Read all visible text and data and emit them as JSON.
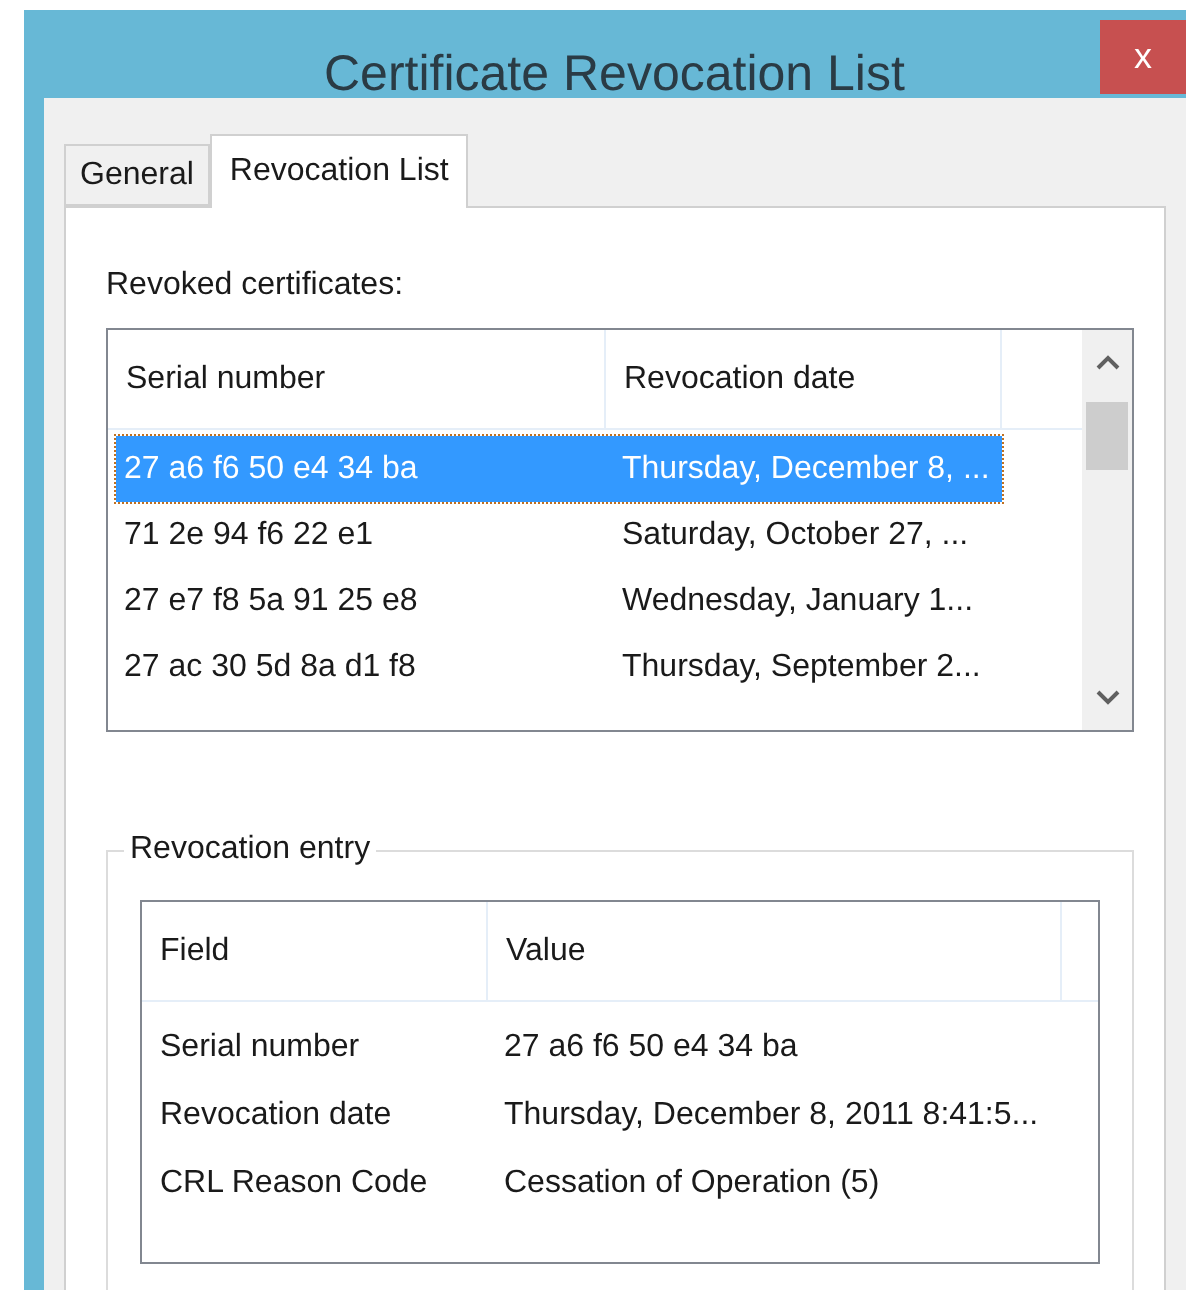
{
  "window": {
    "title": "Certificate Revocation List",
    "close": "x"
  },
  "tabs": [
    {
      "label": "General",
      "selected": false
    },
    {
      "label": "Revocation List",
      "selected": true
    }
  ],
  "revoked_certificates": {
    "label": "Revoked certificates:",
    "columns": [
      "Serial number",
      "Revocation date"
    ],
    "rows": [
      {
        "serial": "27 a6 f6 50 e4 34 ba",
        "date": "Thursday, December 8, ...",
        "selected": true
      },
      {
        "serial": "71 2e 94 f6 22 e1",
        "date": "Saturday, October 27, ...",
        "selected": false
      },
      {
        "serial": "27 e7 f8 5a 91 25 e8",
        "date": "Wednesday, January 1...",
        "selected": false
      },
      {
        "serial": "27 ac 30 5d 8a d1 f8",
        "date": "Thursday, September 2...",
        "selected": false
      }
    ]
  },
  "revocation_entry": {
    "label": "Revocation entry",
    "columns": [
      "Field",
      "Value"
    ],
    "rows": [
      {
        "field": "Serial number",
        "value": "27 a6 f6 50 e4 34 ba"
      },
      {
        "field": "Revocation date",
        "value": "Thursday, December 8, 2011 8:41:5..."
      },
      {
        "field": "CRL Reason Code",
        "value": "Cessation of Operation (5)"
      }
    ]
  }
}
